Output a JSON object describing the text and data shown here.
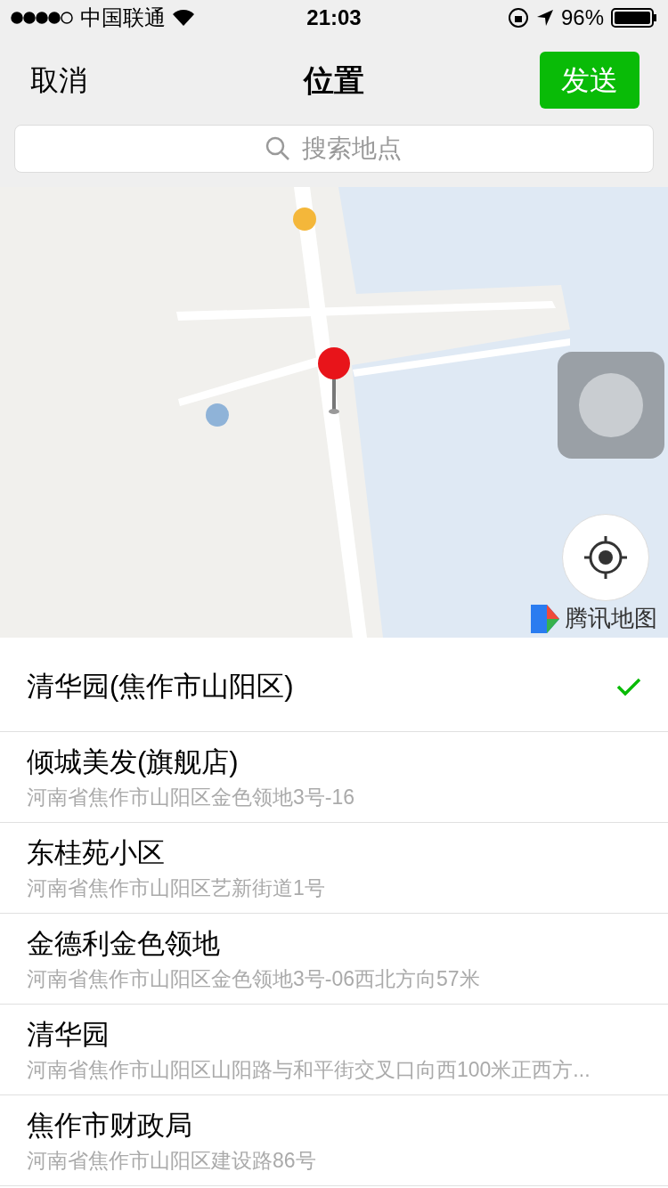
{
  "status_bar": {
    "carrier": "中国联通",
    "time": "21:03",
    "battery": "96%"
  },
  "nav": {
    "cancel": "取消",
    "title": "位置",
    "send": "发送"
  },
  "search": {
    "placeholder": "搜索地点"
  },
  "map": {
    "attribution": "腾讯地图"
  },
  "places": [
    {
      "name": "清华园(焦作市山阳区)",
      "selected": true
    },
    {
      "name": "倾城美发(旗舰店)",
      "address": "河南省焦作市山阳区金色领地3号-16",
      "selected": false
    },
    {
      "name": "东桂苑小区",
      "address": "河南省焦作市山阳区艺新街道1号",
      "selected": false
    },
    {
      "name": "金德利金色领地",
      "address": "河南省焦作市山阳区金色领地3号-06西北方向57米",
      "selected": false
    },
    {
      "name": "清华园",
      "address": "河南省焦作市山阳区山阳路与和平街交叉口向西100米正西方...",
      "selected": false
    },
    {
      "name": "焦作市财政局",
      "address": "河南省焦作市山阳区建设路86号",
      "selected": false
    }
  ]
}
